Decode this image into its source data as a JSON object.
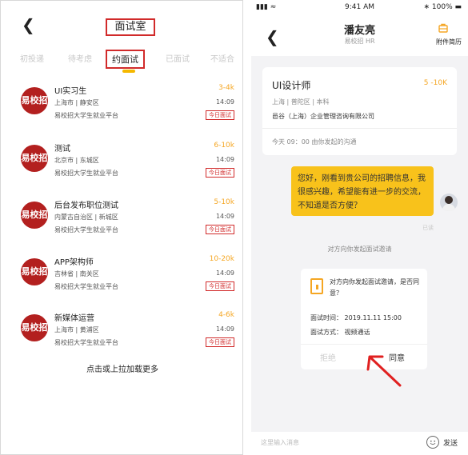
{
  "left": {
    "back_icon": "back-chevron-icon",
    "title": "面试室",
    "tabs": [
      {
        "label": "初投递",
        "active": false
      },
      {
        "label": "待考虑",
        "active": false
      },
      {
        "label": "约面试",
        "active": true
      },
      {
        "label": "已面试",
        "active": false
      },
      {
        "label": "不适合",
        "active": false
      }
    ],
    "jobs": [
      {
        "title": "UI实习生",
        "salary": "3-4k",
        "location": "上海市 | 静安区",
        "time": "14:09",
        "company": "易校招大学生就业平台",
        "badge": "今日面试",
        "logo": "易校招"
      },
      {
        "title": "测试",
        "salary": "6-10k",
        "location": "北京市 | 东城区",
        "time": "14:09",
        "company": "易校招大学生就业平台",
        "badge": "今日面试",
        "logo": "易校招"
      },
      {
        "title": "后台发布职位测试",
        "salary": "5-10k",
        "location": "内蒙古自治区 | 新城区",
        "time": "14:09",
        "company": "易校招大学生就业平台",
        "badge": "今日面试",
        "logo": "易校招"
      },
      {
        "title": "APP架构师",
        "salary": "10-20k",
        "location": "吉林省 | 南关区",
        "time": "14:09",
        "company": "易校招大学生就业平台",
        "badge": "今日面试",
        "logo": "易校招"
      },
      {
        "title": "新媒体运营",
        "salary": "4-6k",
        "location": "上海市 | 黄浦区",
        "time": "14:09",
        "company": "易校招大学生就业平台",
        "badge": "今日面试",
        "logo": "易校招"
      }
    ],
    "load_more": "点击或上拉加载更多"
  },
  "right": {
    "status": {
      "signal": "▮▮▮ ≈",
      "time": "9:41 AM",
      "battery": "∗ 100% ▬"
    },
    "header": {
      "name": "潘友亮",
      "subtitle": "易校招 HR",
      "attach_label": "附件简历"
    },
    "job_card": {
      "title": "UI设计师",
      "salary": "5 -10K",
      "meta": "上海 | 普陀区 | 本科",
      "company": "邑谷（上海）企业管理咨询有限公司",
      "note": "今天 09：00 由你发起的沟通"
    },
    "message": "您好，刚看到贵公司的招聘信息，我很感兴趣，希望能有进一步的交流，不知道是否方便？",
    "read_tag": "已读",
    "system_note": "对方向你发起面试邀请",
    "invite": {
      "text": "对方向你发起面试邀请，是否同意？",
      "time": "面试时间： 2019.11.11  15:00",
      "mode": "面试方式： 视频通话",
      "reject": "拒绝",
      "accept": "同意"
    },
    "input": {
      "placeholder": "这里输入消息",
      "send": "发送"
    }
  },
  "colors": {
    "accent_red": "#d12a2a",
    "salary_orange": "#f5a623",
    "bubble_yellow": "#f8c21b",
    "logo_red": "#b3201f"
  }
}
